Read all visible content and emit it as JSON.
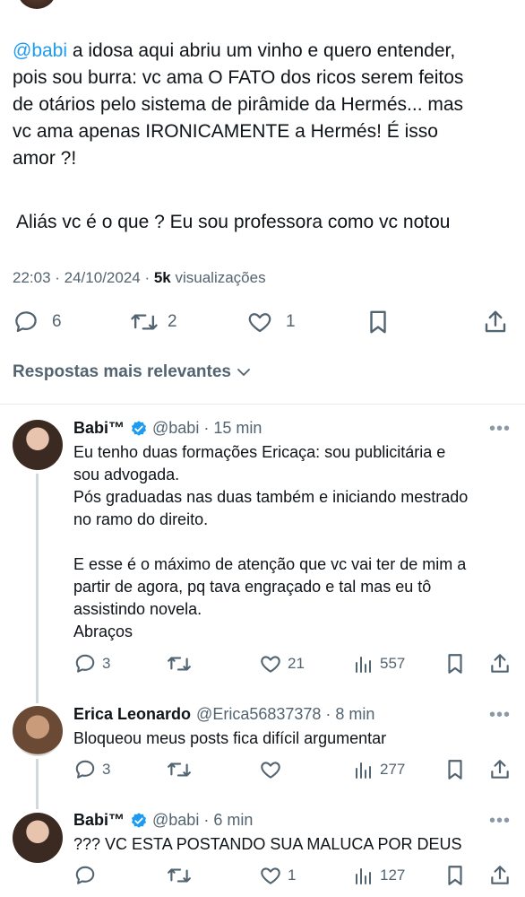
{
  "tweet": {
    "mention": "@babi",
    "text_lines": [
      " a idosa aqui abriu um vinho e quero entender,",
      "pois sou burra: vc ama O FATO dos ricos serem  feitos",
      "de otários pelo sistema de pirâmide da Hermés...  mas",
      "vc ama apenas IRONICAMENTE a Hermés! É isso",
      "amor ?!"
    ],
    "aside": "Aliás vc é o que ? Eu sou professora como vc notou",
    "time": "22:03 · 24/10/2024 · ",
    "views_count": "5k",
    "views_label": " visualizações",
    "replies": "6",
    "retweets": "2",
    "likes": "1"
  },
  "replies_header": "Respostas mais relevantes",
  "replies": [
    {
      "name": "Babi™",
      "verified": true,
      "handle": "@babi · 15 min",
      "lines": [
        "Eu tenho duas formações Ericaça: sou publicitária e",
        "sou advogada.",
        "Pós graduadas nas duas também e iniciando mestrado",
        "no ramo do direito.",
        "",
        "E esse é o máximo de atenção que vc vai ter de mim a",
        "partir de agora, pq tava engraçado e tal mas eu tô",
        "assistindo novela.",
        "Abraços"
      ],
      "replies": "3",
      "retweets": "",
      "likes": "21",
      "views": "557"
    },
    {
      "name": "Erica Leonardo",
      "verified": false,
      "handle": "@Erica56837378 · 8 min",
      "lines": [
        "Bloqueou meus posts fica difícil argumentar"
      ],
      "replies": "3",
      "retweets": "",
      "likes": "",
      "views": "277"
    },
    {
      "name": "Babi™",
      "verified": true,
      "handle": "@babi · 6 min",
      "lines": [
        "??? VC ESTA POSTANDO SUA MALUCA POR DEUS"
      ],
      "replies": "",
      "retweets": "",
      "likes": "1",
      "views": "127"
    }
  ],
  "more_glyph": "•••",
  "colors": {
    "accent": "#1d9bf0",
    "muted": "#536471",
    "text": "#0f1419",
    "divider": "#e7e9ea"
  }
}
